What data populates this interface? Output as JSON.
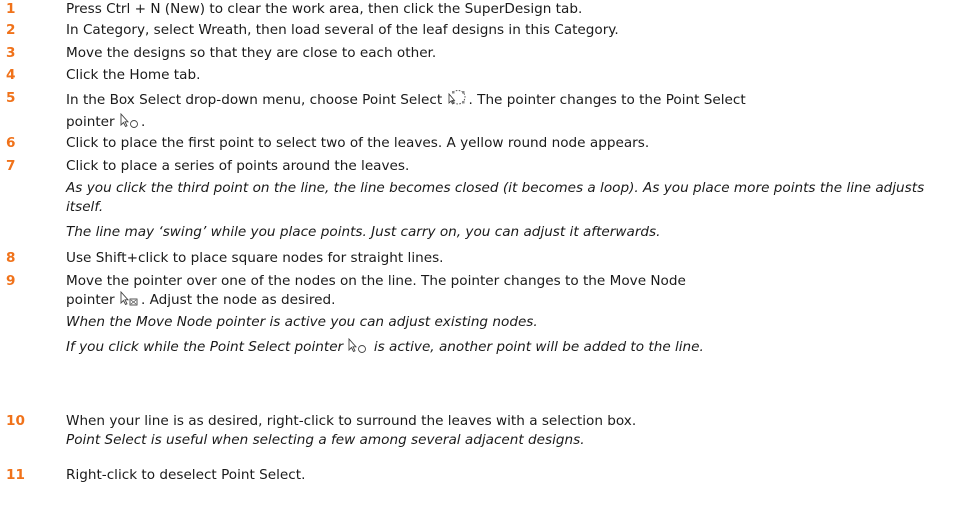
{
  "steps": [
    {
      "num": "1",
      "text": "Press Ctrl + N (New) to clear the work area, then click the SuperDesign tab."
    },
    {
      "num": "2",
      "text": "In Category, select Wreath, then load several of the leaf designs in this Category."
    },
    {
      "num": "3",
      "text": "Move the designs so that they are close to each other."
    },
    {
      "num": "4",
      "text": "Click the Home tab."
    },
    {
      "num": "5",
      "text_a": "In the Box Select drop-down menu, choose Point Select",
      "text_b": ". The pointer changes to the Point Select",
      "text_c": "pointer",
      "text_d": "."
    },
    {
      "num": "6",
      "text": "Click to place the first point to select two of the leaves. A yellow round node appears."
    },
    {
      "num": "7",
      "text": "Click to place a series of points around the leaves.",
      "note1": "As you click the third point on the line, the line becomes closed (it becomes a loop). As you place more points the line adjusts itself.",
      "note2": "The line may ‘swing’ while you place points. Just carry on, you can adjust it afterwards."
    },
    {
      "num": "8",
      "text": "Use Shift+click to place square nodes for straight lines."
    },
    {
      "num": "9",
      "text_a": "Move the pointer over one of the nodes on the line. The pointer changes to the Move Node",
      "text_b": "pointer",
      "text_c": ". Adjust the node as desired.",
      "note1": "When the Move Node pointer is active you can adjust existing nodes.",
      "note2_a": "If you click while the Point Select pointer",
      "note2_b": "is active, another point will be added to the line."
    },
    {
      "num": "10",
      "text": "When your line is as desired, right-click to surround the leaves with a selection box.",
      "note1": "Point Select is useful when selecting a few among several adjacent designs."
    },
    {
      "num": "11",
      "text": "Right-click to deselect Point Select."
    }
  ],
  "icons": {
    "point_select_tool": "point-select-icon",
    "point_select_pointer": "point-select-pointer-icon",
    "move_node_pointer": "move-node-pointer-icon"
  },
  "colors": {
    "step_number": "#f0721a",
    "text": "#1a1a1a"
  }
}
